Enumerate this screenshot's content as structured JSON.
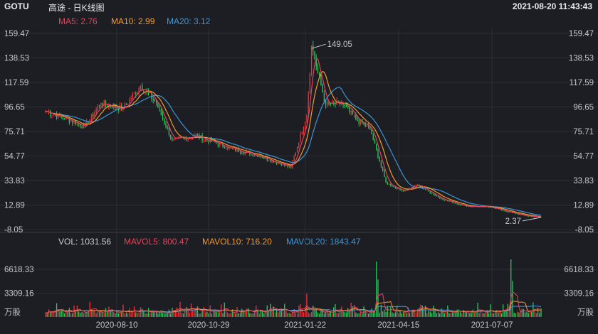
{
  "header": {
    "ticker": "GOTU",
    "subtitle": "高途 - 日K线图",
    "datetime": "2021-08-20 11:43:43"
  },
  "colors": {
    "bg": "#1c1e23",
    "grid": "#2c2f36",
    "up": "#e8333a",
    "down": "#2ec35f",
    "ma5": "#e2445c",
    "ma10": "#f29a2e",
    "ma20": "#3d95d6",
    "text": "#c9ccd2"
  },
  "price_legend": [
    {
      "label": "MA5: 2.76",
      "color": "#e2445c"
    },
    {
      "label": "MA10: 2.99",
      "color": "#f29a2e"
    },
    {
      "label": "MA20: 3.12",
      "color": "#3d95d6"
    }
  ],
  "volume_legend": [
    {
      "label": "VOL: 1031.56",
      "color": "#c9ccd2"
    },
    {
      "label": "MAVOL5: 800.47",
      "color": "#e2445c"
    },
    {
      "label": "MAVOL10: 716.20",
      "color": "#f29a2e"
    },
    {
      "label": "MAVOL20: 1843.47",
      "color": "#3d95d6"
    }
  ],
  "volume_unit": "万股",
  "chart_data": [
    {
      "type": "candlestick",
      "title": "GOTU 高途 - 日K线图",
      "y_ticks": [
        159.47,
        138.53,
        117.59,
        96.65,
        75.71,
        54.77,
        33.83,
        12.89,
        -8.05
      ],
      "ylim": [
        -8.05,
        159.47
      ],
      "x_ticks": [
        "2020-08-10",
        "2020-10-29",
        "2021-01-22",
        "2021-04-15",
        "2021-07-07"
      ],
      "annotations": [
        {
          "text": "149.05",
          "x": "2021-01-28",
          "y": 149.05
        },
        {
          "text": "2.37",
          "x": "2021-08-19",
          "y": 2.37
        }
      ],
      "series": [
        {
          "name": "MA5",
          "last": 2.76
        },
        {
          "name": "MA10",
          "last": 2.99
        },
        {
          "name": "MA20",
          "last": 3.12
        }
      ],
      "anchors": [
        {
          "date": "2020-06-08",
          "close": 93
        },
        {
          "date": "2020-06-22",
          "close": 88
        },
        {
          "date": "2020-07-13",
          "close": 80
        },
        {
          "date": "2020-07-27",
          "close": 100
        },
        {
          "date": "2020-08-14",
          "close": 95
        },
        {
          "date": "2020-08-31",
          "close": 115
        },
        {
          "date": "2020-09-14",
          "close": 100
        },
        {
          "date": "2020-09-28",
          "close": 68
        },
        {
          "date": "2020-10-19",
          "close": 72
        },
        {
          "date": "2020-11-16",
          "close": 62
        },
        {
          "date": "2020-12-14",
          "close": 55
        },
        {
          "date": "2021-01-11",
          "close": 45
        },
        {
          "date": "2021-01-25",
          "close": 90
        },
        {
          "date": "2021-01-28",
          "close": 149.05
        },
        {
          "date": "2021-02-10",
          "close": 98
        },
        {
          "date": "2021-02-24",
          "close": 100
        },
        {
          "date": "2021-03-10",
          "close": 85
        },
        {
          "date": "2021-03-22",
          "close": 78
        },
        {
          "date": "2021-04-05",
          "close": 32
        },
        {
          "date": "2021-04-19",
          "close": 25
        },
        {
          "date": "2021-05-03",
          "close": 30
        },
        {
          "date": "2021-05-24",
          "close": 18
        },
        {
          "date": "2021-06-14",
          "close": 12
        },
        {
          "date": "2021-07-07",
          "close": 11
        },
        {
          "date": "2021-07-21",
          "close": 7
        },
        {
          "date": "2021-08-04",
          "close": 4
        },
        {
          "date": "2021-08-19",
          "close": 2.37
        }
      ]
    },
    {
      "type": "bar",
      "title": "VOL (万股)",
      "y_ticks": [
        6618.33,
        3309.16
      ],
      "ylim": [
        0,
        8200
      ],
      "series": [
        {
          "name": "VOL",
          "last": 1031.56
        },
        {
          "name": "MAVOL5",
          "last": 800.47
        },
        {
          "name": "MAVOL10",
          "last": 716.2
        },
        {
          "name": "MAVOL20",
          "last": 1843.47
        }
      ],
      "spikes": [
        {
          "date": "2021-01-25",
          "value": 3200
        },
        {
          "date": "2021-03-26",
          "value": 7700
        },
        {
          "date": "2021-03-29",
          "value": 5200
        },
        {
          "date": "2021-07-23",
          "value": 8000
        },
        {
          "date": "2021-07-26",
          "value": 5000
        }
      ]
    }
  ]
}
